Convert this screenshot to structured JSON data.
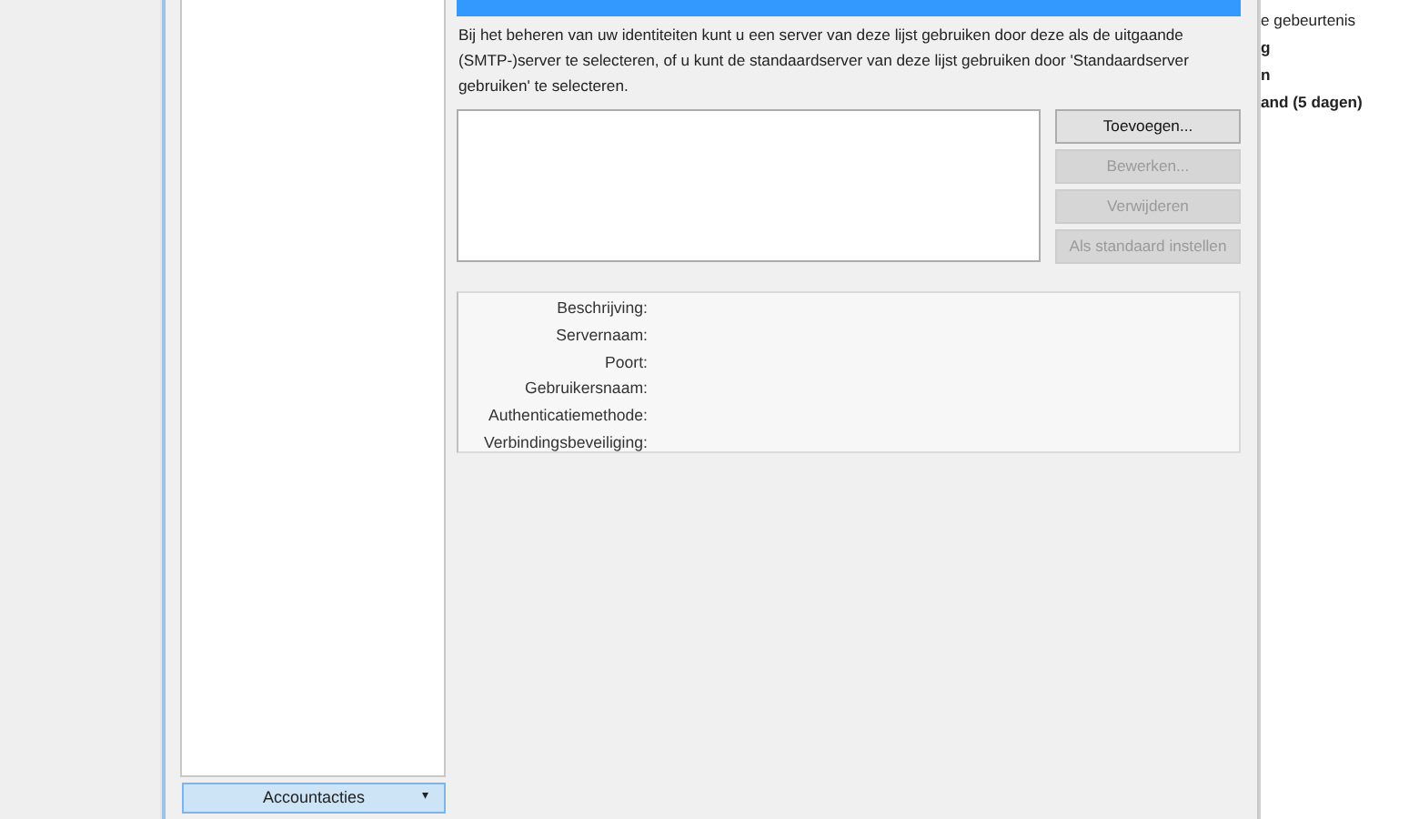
{
  "dialog": {
    "account_actions_button": {
      "label": "Accountacties",
      "caret": "▾"
    },
    "description": "Bij het beheren van uw identiteiten kunt u een server van deze lijst gebruiken door deze als de uitgaande (SMTP-)server te selecteren, of u kunt de standaardserver van deze lijst gebruiken door 'Standaardserver gebruiken' te selecteren.",
    "buttons": [
      {
        "label": "Toevoegen...",
        "disabled": false
      },
      {
        "label": "Bewerken...",
        "disabled": true
      },
      {
        "label": "Verwijderen",
        "disabled": true
      },
      {
        "label": "Als standaard instellen",
        "disabled": true
      }
    ],
    "details": [
      {
        "label": "Beschrijving:"
      },
      {
        "label": "Servernaam:"
      },
      {
        "label": "Poort:"
      },
      {
        "label": "Gebruikersnaam:"
      },
      {
        "label": "Authenticatiemethode:"
      },
      {
        "label": "Verbindingsbeveiliging:"
      }
    ]
  },
  "background_panel": {
    "lines": [
      {
        "text": "e gebeurtenis",
        "bold": false
      },
      {
        "text": "g",
        "bold": true
      },
      {
        "text": "n",
        "bold": true
      },
      {
        "text": "and (5 dagen)",
        "bold": true
      }
    ]
  }
}
